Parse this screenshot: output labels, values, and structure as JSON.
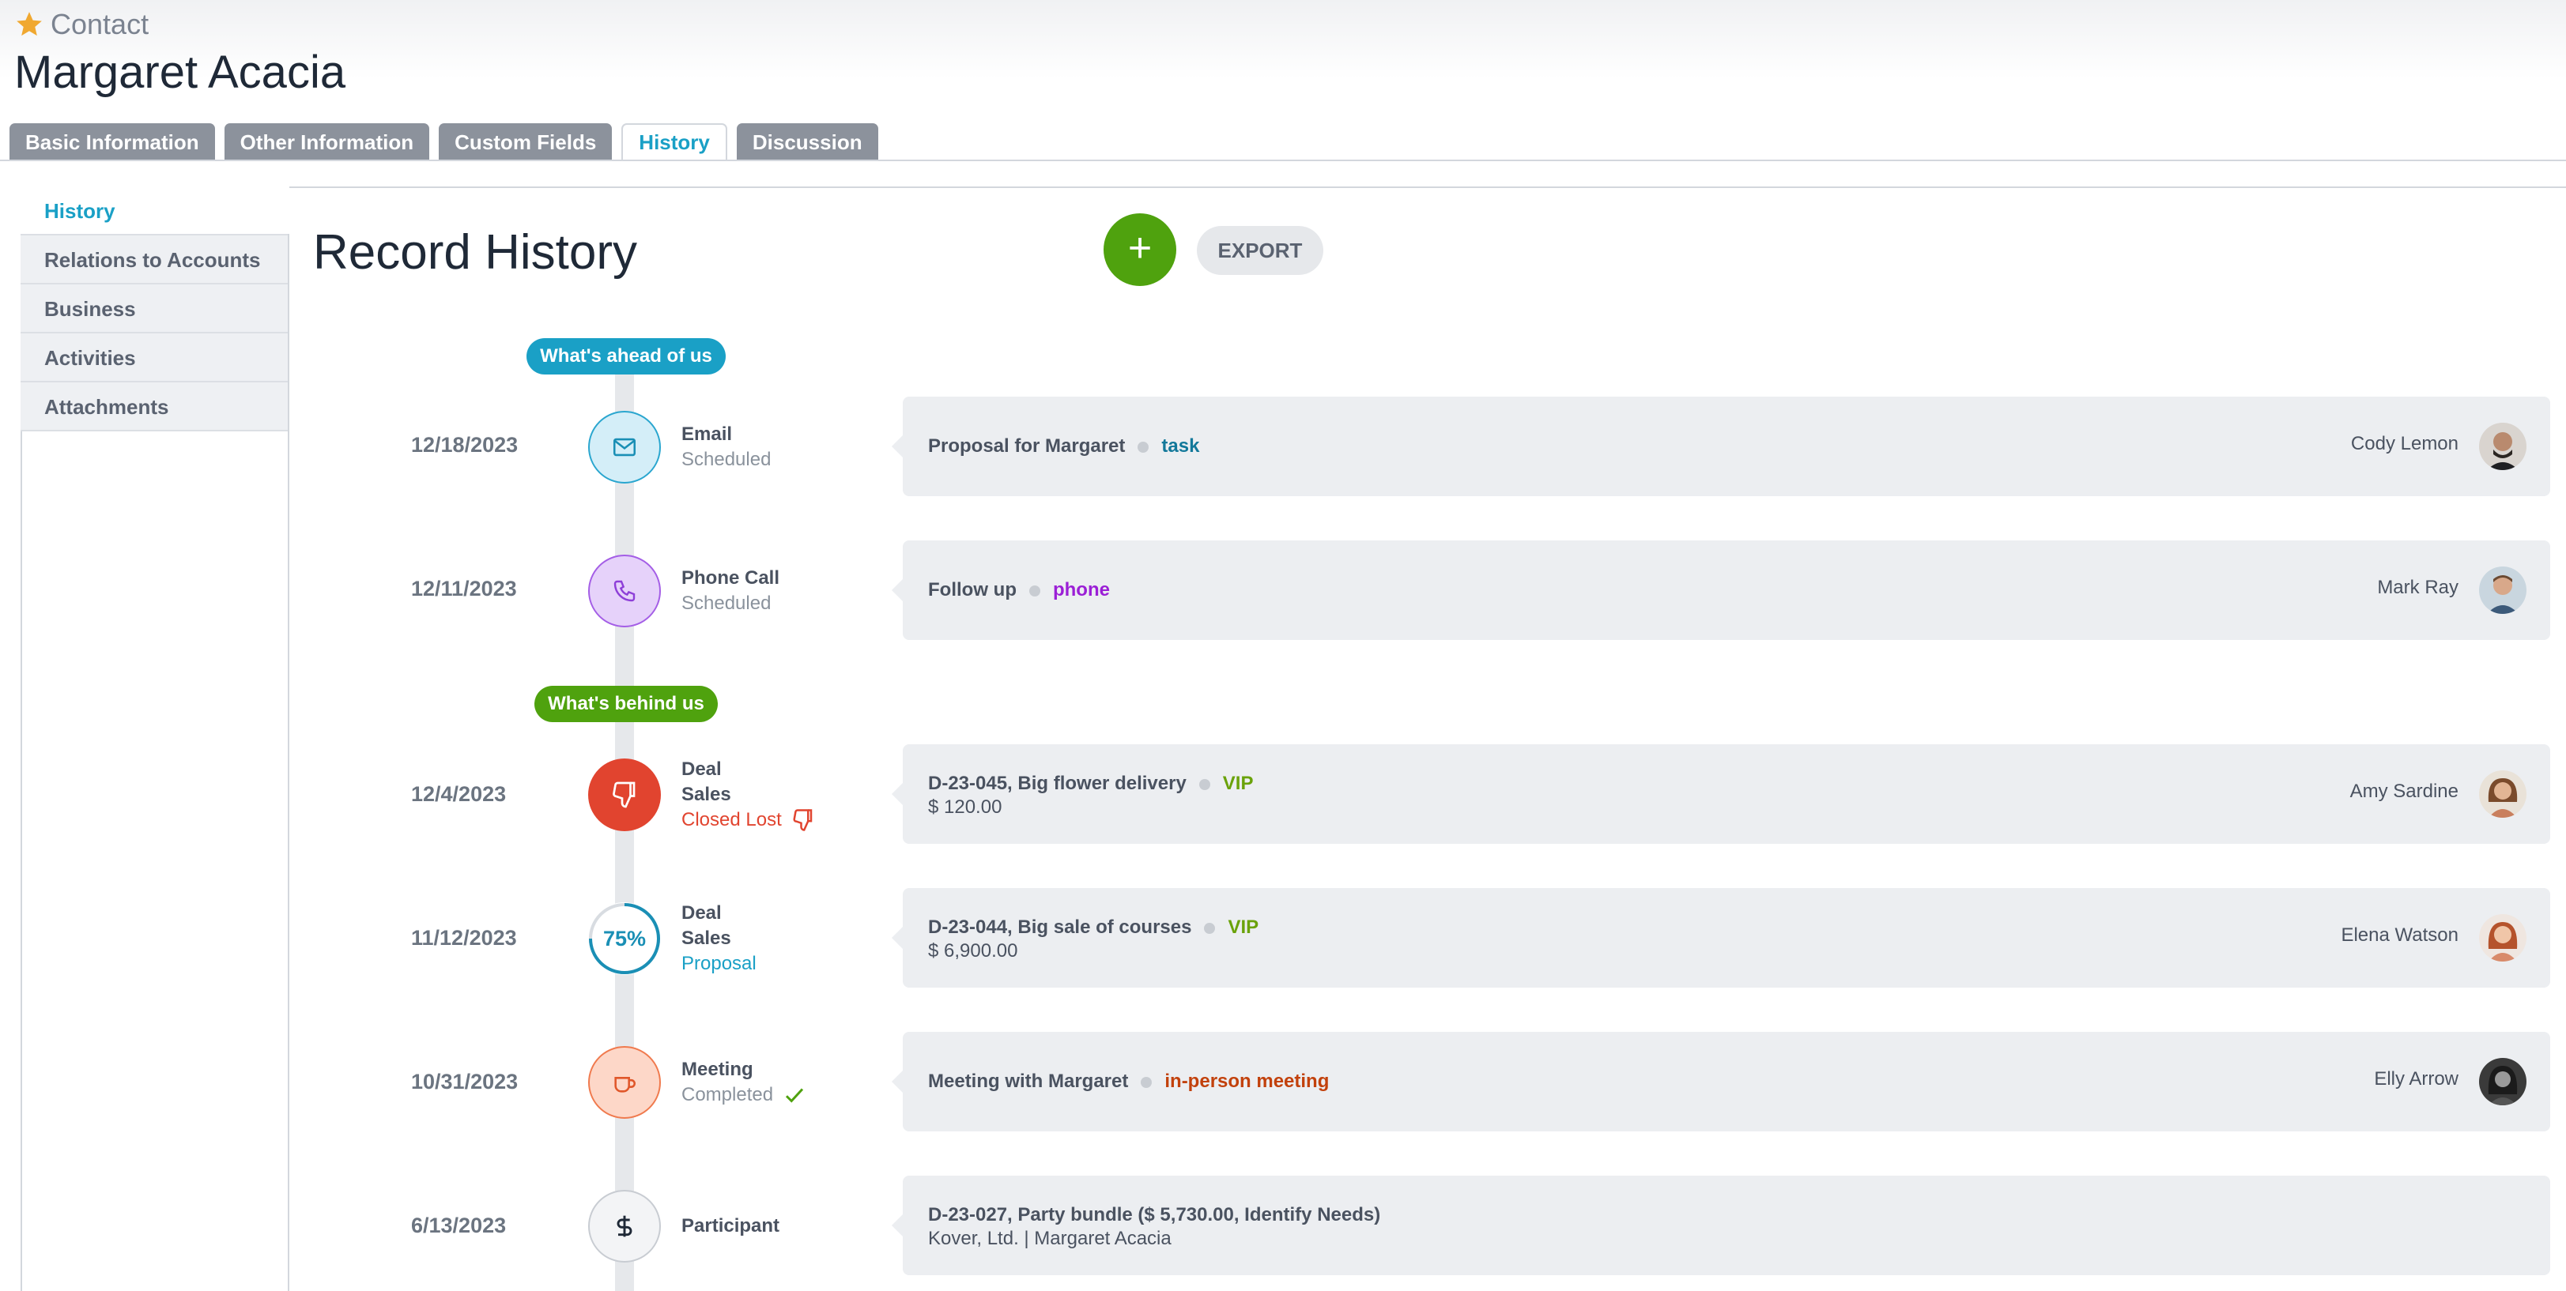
{
  "header": {
    "breadcrumb": "Contact",
    "title": "Margaret Acacia"
  },
  "tabs": [
    {
      "label": "Basic Information",
      "active": false
    },
    {
      "label": "Other Information",
      "active": false
    },
    {
      "label": "Custom Fields",
      "active": false
    },
    {
      "label": "History",
      "active": true
    },
    {
      "label": "Discussion",
      "active": false
    }
  ],
  "sidebar": {
    "items": [
      {
        "label": "History",
        "active": true
      },
      {
        "label": "Relations to Accounts"
      },
      {
        "label": "Business"
      },
      {
        "label": "Activities"
      },
      {
        "label": "Attachments"
      }
    ]
  },
  "main": {
    "title": "Record History",
    "add_label": "+",
    "export_label": "EXPORT"
  },
  "timeline": {
    "ahead_label": "What's ahead of us",
    "behind_label": "What's behind us",
    "rows": [
      {
        "date": "12/18/2023",
        "icon": "envelope-icon",
        "type": "Email",
        "status": "Scheduled",
        "title": "Proposal for Margaret",
        "tag": "task",
        "tag_color": "#12789a",
        "owner": "Cody Lemon"
      },
      {
        "date": "12/11/2023",
        "icon": "phone-icon",
        "type": "Phone Call",
        "status": "Scheduled",
        "title": "Follow up",
        "tag": "phone",
        "tag_color": "#9b1fd6",
        "owner": "Mark Ray"
      },
      {
        "date": "12/4/2023",
        "icon": "thumbs-down-icon",
        "type": "Deal",
        "subtype": "Sales",
        "status": "Closed Lost",
        "title": "D-23-045, Big flower delivery",
        "tag": "VIP",
        "tag_color": "#6aa20a",
        "amount": "$ 120.00",
        "owner": "Amy Sardine"
      },
      {
        "date": "11/12/2023",
        "icon": "progress-icon",
        "progress": "75%",
        "type": "Deal",
        "subtype": "Sales",
        "status": "Proposal",
        "title": "D-23-044, Big sale of courses",
        "tag": "VIP",
        "tag_color": "#6aa20a",
        "amount": "$ 6,900.00",
        "owner": "Elena Watson"
      },
      {
        "date": "10/31/2023",
        "icon": "coffee-cup-icon",
        "type": "Meeting",
        "status": "Completed",
        "title": "Meeting with Margaret",
        "tag": "in-person meeting",
        "tag_color": "#c2410c",
        "owner": "Elly Arrow"
      },
      {
        "date": "6/13/2023",
        "icon": "dollar-icon",
        "type": "Participant",
        "title": "D-23-027, Party bundle ($ 5,730.00, Identify Needs)",
        "subtitle": "Kover, Ltd. | Margaret Acacia"
      }
    ]
  }
}
